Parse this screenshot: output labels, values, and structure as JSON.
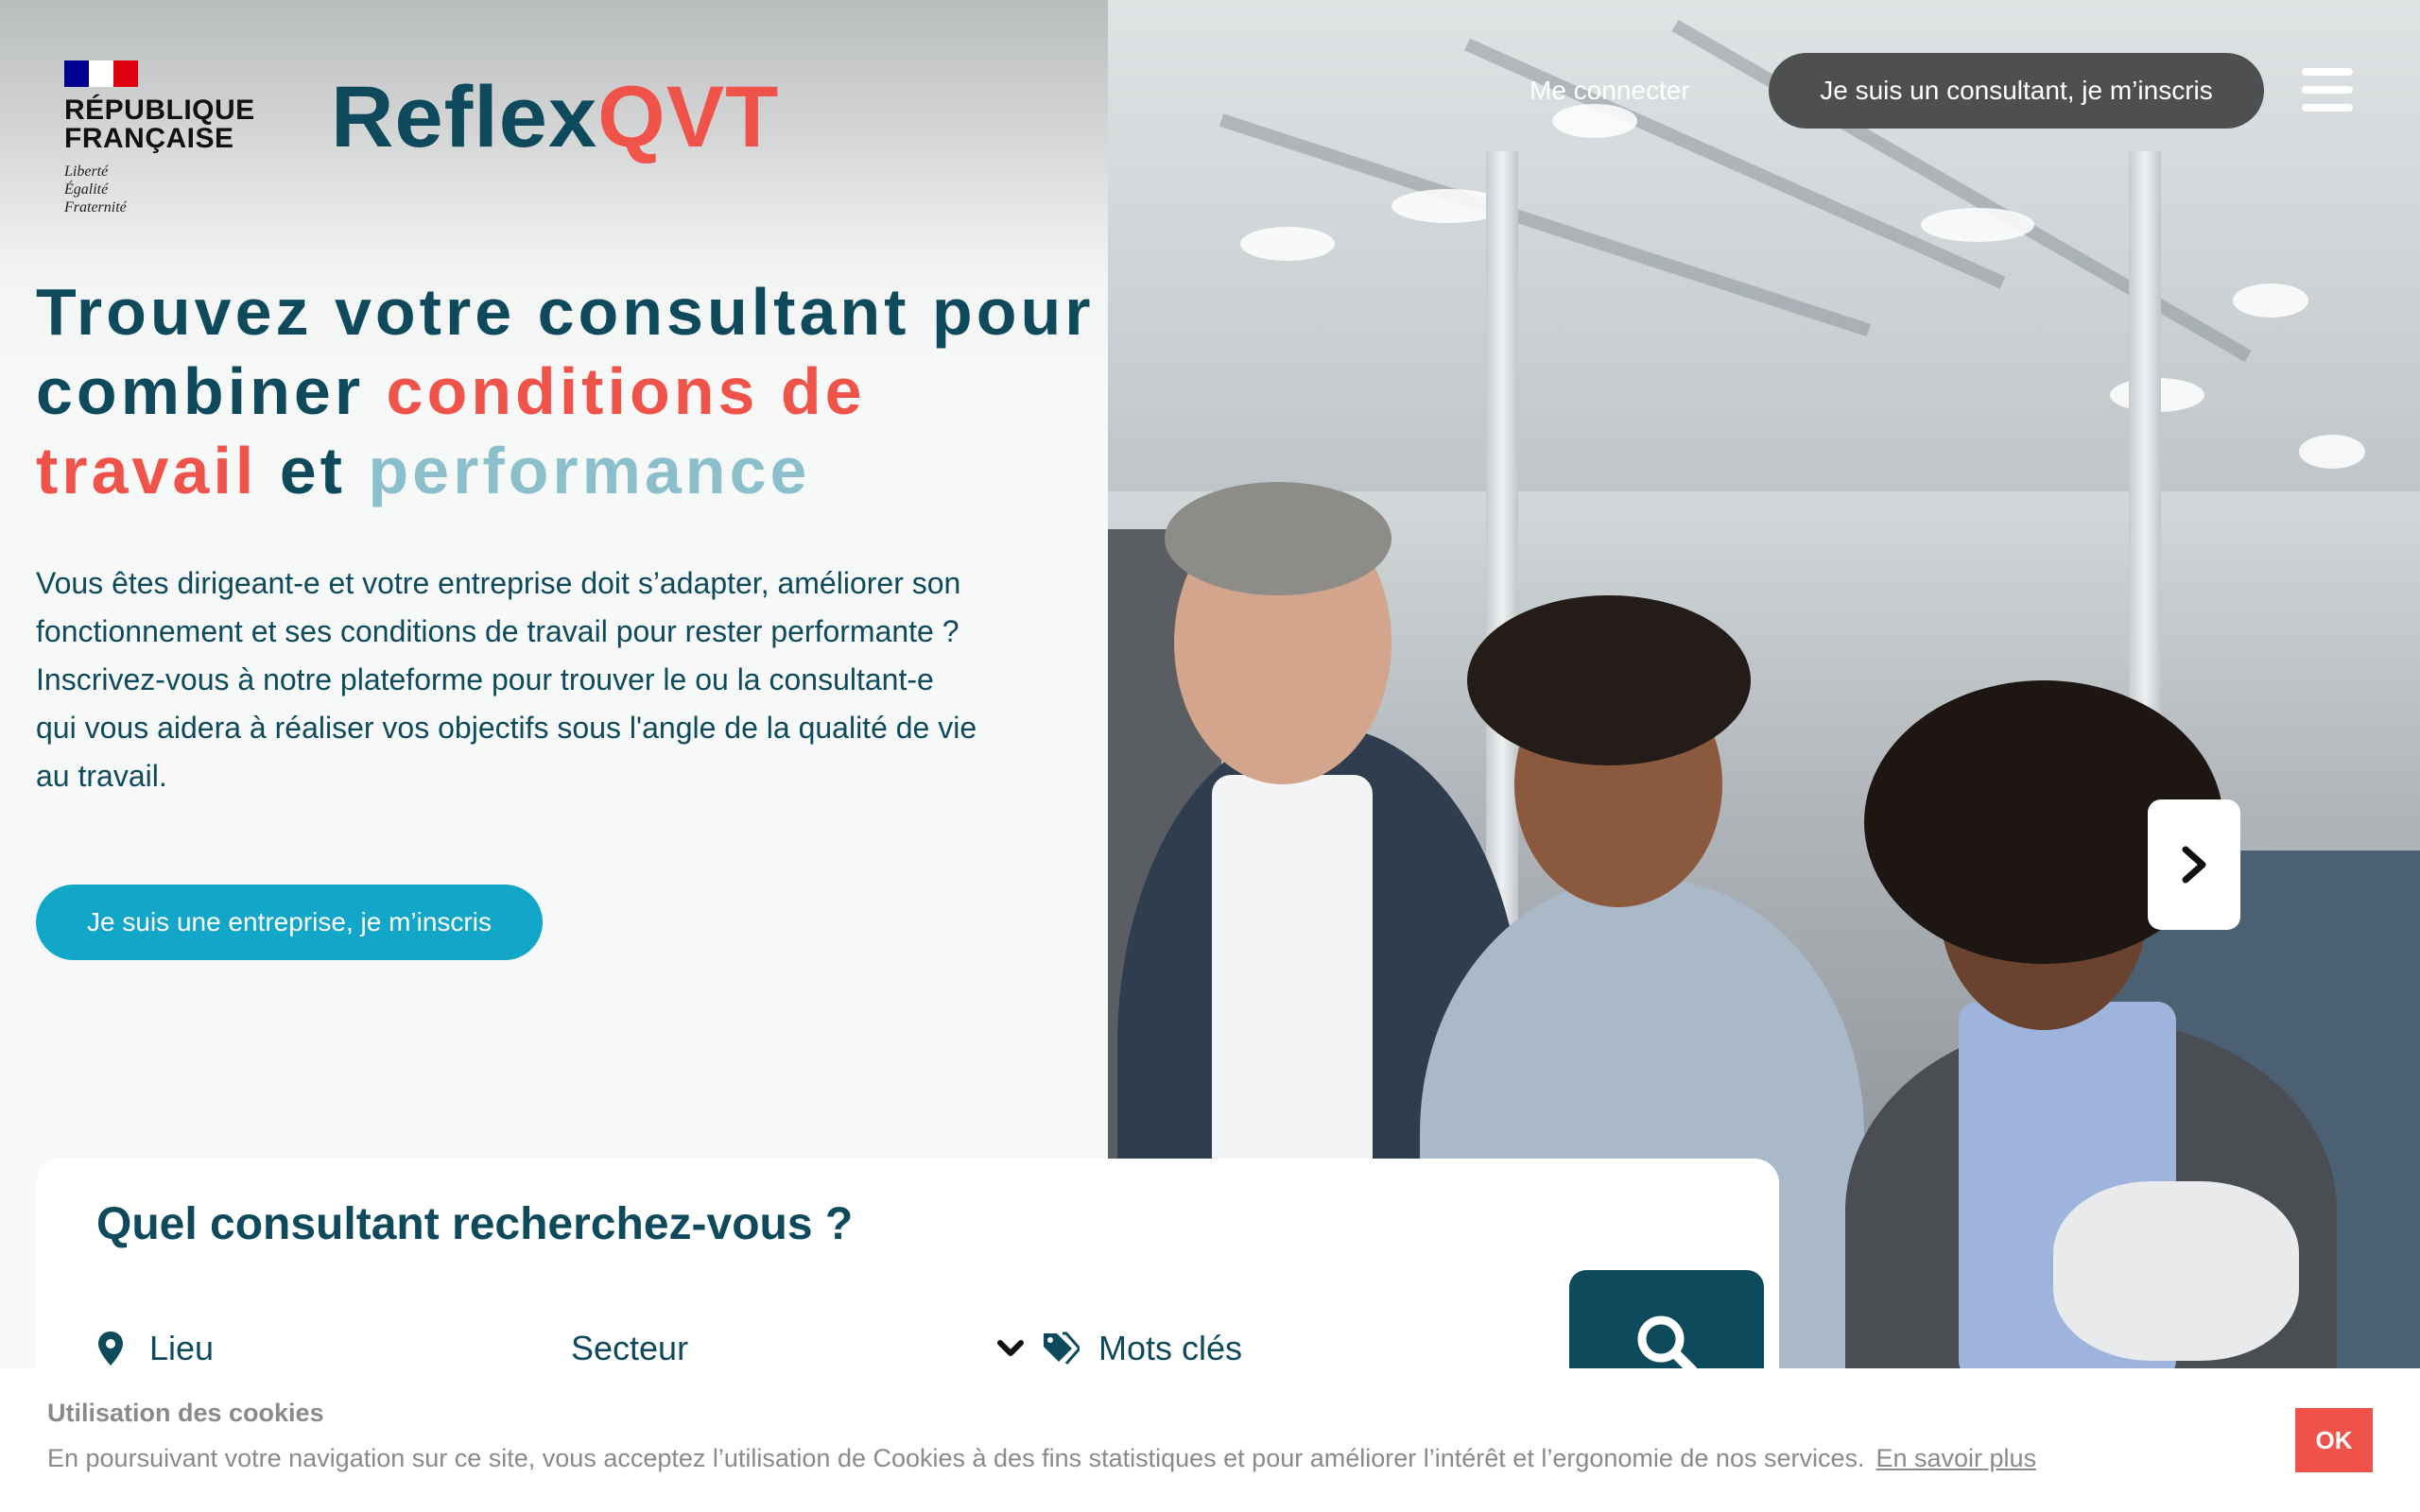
{
  "header": {
    "republic_name_line1": "RÉPUBLIQUE",
    "republic_name_line2": "FRANÇAISE",
    "motto_line1": "Liberté",
    "motto_line2": "Égalité",
    "motto_line3": "Fraternité",
    "brand_part1": "Reflex",
    "brand_part2": "QVT",
    "login_label": "Me connecter",
    "consultant_signup_label": "Je suis un consultant, je m’inscris",
    "menu_icon": "hamburger-menu-icon"
  },
  "hero": {
    "headline_part1": "Trouvez votre consultant pour combiner ",
    "headline_highlight1": "conditions de travail",
    "headline_part2": " et ",
    "headline_highlight2": "performance",
    "intro_paragraph1": "Vous êtes dirigeant-e et votre entreprise doit s’adapter, améliorer son fonctionnement et ses conditions de travail pour rester performante ?",
    "intro_paragraph2": "Inscrivez-vous à notre plateforme pour trouver le ou la consultant-e qui vous aidera à réaliser vos objectifs sous l'angle de la qualité de vie au travail.",
    "company_signup_label": "Je suis une entreprise, je m’inscris",
    "carousel_next_icon": "chevron-right-icon"
  },
  "search": {
    "title": "Quel consultant recherchez-vous ?",
    "location_label": "Lieu",
    "sector_label": "Secteur",
    "keywords_label": "Mots clés",
    "search_icon": "search-icon"
  },
  "cookie_banner": {
    "title": "Utilisation des cookies",
    "text": "En poursuivant votre navigation sur ce site, vous acceptez l’utilisation de Cookies à des fins statistiques et pour améliorer l’intérêt et l’ergonomie de nos services.",
    "link_label": "En savoir plus",
    "ok_label": "OK"
  },
  "colors": {
    "navy": "#0e4a5c",
    "coral": "#f0534a",
    "teal_light": "#8bbfcb",
    "cyan_button": "#12a6c8",
    "dark_pill": "#4e4f50",
    "flag_blue": "#000091",
    "flag_red": "#e1000f"
  }
}
